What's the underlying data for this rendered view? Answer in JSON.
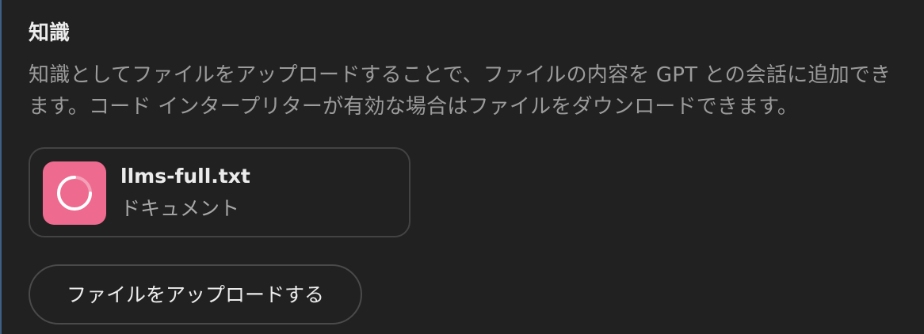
{
  "knowledge": {
    "title": "知識",
    "description": "知識としてファイルをアップロードすることで、ファイルの内容を GPT との会話に追加できます。コード インタープリターが有効な場合はファイルをダウンロードできます。"
  },
  "files": [
    {
      "name": "llms-full.txt",
      "type": "ドキュメント",
      "icon": "spinner-icon",
      "icon_bg": "#ef6a8f"
    }
  ],
  "upload_button_label": "ファイルをアップロードする"
}
